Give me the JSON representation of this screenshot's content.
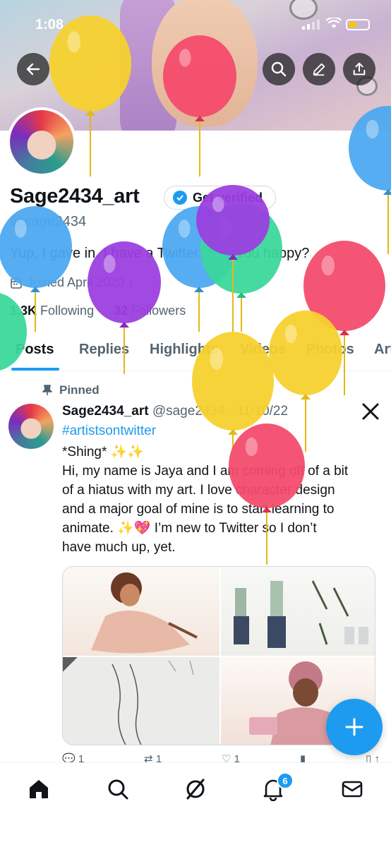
{
  "status_bar": {
    "time": "1:08"
  },
  "profile": {
    "name": "Sage2434_art",
    "handle": "@sage2434",
    "get_verified_label": "Get verified",
    "bio": "Yup, I gave in. I have a Twitter now. You happy?",
    "joined": "Joined April 2020",
    "following_count": "1.3K",
    "following_label": "Following",
    "followers_count": "32",
    "followers_label": "Followers"
  },
  "tabs": [
    "Posts",
    "Replies",
    "Highlights",
    "Videos",
    "Photos",
    "Articles"
  ],
  "post": {
    "pinned_label": "Pinned",
    "author_name": "Sage2434_art",
    "author_handle": "@sage2434",
    "date": "11/10/22",
    "hashtag": "#artistsontwitter",
    "lines": [
      "*Shing* ✨✨",
      "Hi, my name is Jaya and I am coming off of a bit",
      "of a hiatus with my art. I love character design",
      "and a major goal of mine is to start learning to",
      "animate. ✨💖 I’m new to Twitter so I don’t",
      "have much up, yet."
    ],
    "counts": {
      "replies": "1",
      "reposts": "1",
      "likes": "1"
    }
  },
  "nav": {
    "notifications_badge": "6"
  },
  "colors": {
    "accent": "#1d9bf0",
    "text": "#0f1419",
    "muted": "#536471"
  },
  "icons": [
    "back-arrow-icon",
    "search-icon",
    "edit-icon",
    "share-icon",
    "verified-badge-icon",
    "calendar-icon",
    "pin-icon",
    "x-logo-icon",
    "compose-plus-icon",
    "home-icon",
    "grok-icon",
    "bell-icon",
    "mail-icon"
  ]
}
